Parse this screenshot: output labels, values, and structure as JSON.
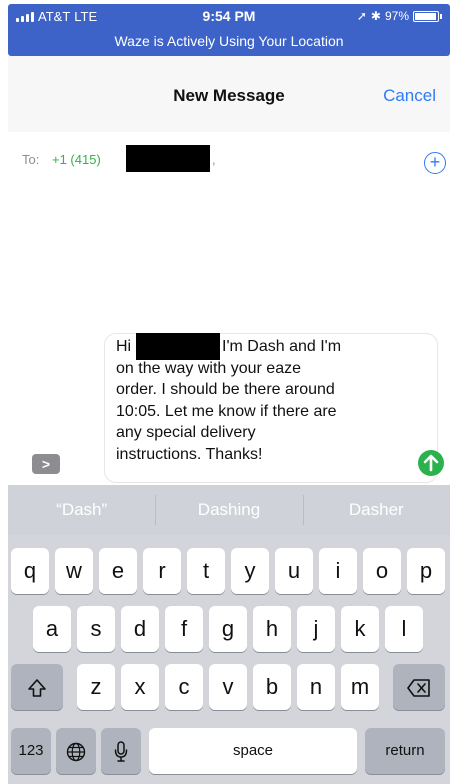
{
  "status_bar": {
    "carrier": "AT&T",
    "network": "LTE",
    "time": "9:54 PM",
    "battery_percent": "97%",
    "location_banner": "Waze is Actively Using Your Location"
  },
  "nav": {
    "title": "New Message",
    "cancel_label": "Cancel"
  },
  "recipients": {
    "label": "To:",
    "number_prefix": "+1 (415)",
    "separator": ","
  },
  "compose": {
    "message_lines": [
      "Hi",
      "on the way with your eaze",
      "order. I should be there around",
      "10:05. Let me know if there are",
      "any special delivery",
      "instructions. Thanks!"
    ],
    "message_line1_tail": ", I'm Dash and I'm",
    "expand_label": ">"
  },
  "suggestions": [
    "“Dash”",
    "Dashing",
    "Dasher"
  ],
  "keyboard": {
    "row1": [
      "q",
      "w",
      "e",
      "r",
      "t",
      "y",
      "u",
      "i",
      "o",
      "p"
    ],
    "row2": [
      "a",
      "s",
      "d",
      "f",
      "g",
      "h",
      "j",
      "k",
      "l"
    ],
    "row3": [
      "z",
      "x",
      "c",
      "v",
      "b",
      "n",
      "m"
    ],
    "numbers_label": "123",
    "space_label": "space",
    "return_label": "return"
  },
  "colors": {
    "status_bar": "#3d63c9",
    "link_blue": "#2f7bf5",
    "send_green": "#2bb24c",
    "recipient_green": "#34b24b"
  }
}
